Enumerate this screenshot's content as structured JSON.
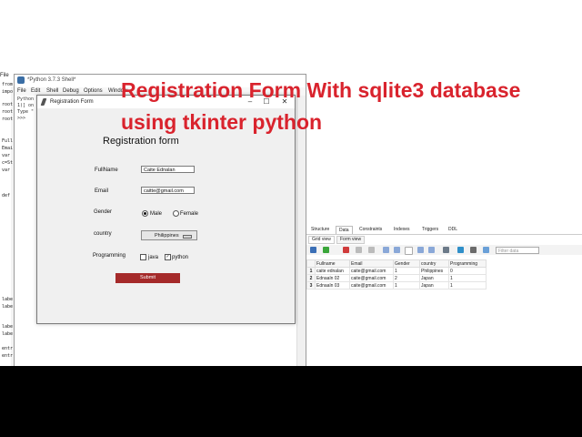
{
  "headline": {
    "line1": "Registration Form With sqlite3 database",
    "line2": "using tkinter python",
    "color": "#d9232d"
  },
  "editor": {
    "menu_file": "File",
    "code_lines": [
      "from",
      "impo",
      "root",
      "root",
      "root",
      "Full",
      "Emai",
      "var",
      "c=St",
      "var",
      "def",
      "labe",
      "labe",
      "labe",
      "labe",
      "entr",
      "entr"
    ]
  },
  "shell": {
    "title": "*Python 3.7.3 Shell*",
    "menu": [
      "File",
      "Edit",
      "Shell",
      "Debug",
      "Options",
      "Window"
    ],
    "lines": [
      "Python",
      "1)] on",
      "Type \"",
      ">>>"
    ]
  },
  "form": {
    "window_title": "Registration Form",
    "controls": {
      "minimize": "–",
      "maximize": "☐",
      "close": "✕"
    },
    "heading": "Registration form",
    "fullname_label": "FullName",
    "fullname_value": "Caite Ednalan",
    "email_label": "Email",
    "email_value": "caitte@gmail.com",
    "gender_label": "Gender",
    "gender_options": [
      "Male",
      "Female"
    ],
    "gender_selected": "Male",
    "country_label": "country",
    "country_value": "Philippines",
    "programming_label": "Programming",
    "programming_options": [
      "java",
      "python"
    ],
    "programming_checked": [
      "python"
    ],
    "submit_label": "Submit",
    "submit_color": "#a52a2a"
  },
  "db": {
    "tabs": [
      "Structure",
      "Data",
      "Constraints",
      "Indexes",
      "Triggers",
      "DDL"
    ],
    "active_tab": "Data",
    "subtabs": [
      "Grid view",
      "Form view"
    ],
    "active_subtab": "Grid view",
    "filter_placeholder": "Filter data",
    "columns": [
      "",
      "Fullname",
      "Email",
      "Gender",
      "country",
      "Programming"
    ],
    "rows": [
      [
        "1",
        "caite ednalan",
        "caite@gmail.com",
        "1",
        "Philippines",
        "0"
      ],
      [
        "2",
        "Ednaaln 02",
        "caite@gmail.com",
        "2",
        "Japan",
        "1"
      ],
      [
        "3",
        "Ednaaln 03",
        "caite@gmail.com",
        "1",
        "Japan",
        "1"
      ]
    ]
  }
}
